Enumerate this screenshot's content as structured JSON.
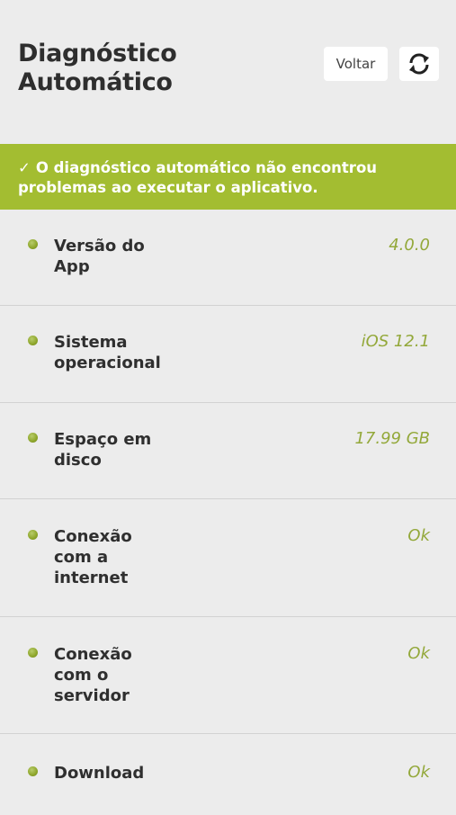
{
  "header": {
    "title_line1": "Diagnóstico",
    "title_line2": "Automático",
    "back_label": "Voltar"
  },
  "banner": {
    "check": "✓",
    "message": "O diagnóstico automático não encontrou problemas ao executar o aplicativo."
  },
  "colors": {
    "accent": "#a3bd31",
    "value_text": "#93a83a",
    "background": "#ececec"
  },
  "items": [
    {
      "label": "Versão do App",
      "value": "4.0.0"
    },
    {
      "label": "Sistema operacional",
      "value": "iOS 12.1"
    },
    {
      "label": "Espaço em disco",
      "value": "17.99 GB"
    },
    {
      "label": "Conexão com a internet",
      "value": "Ok"
    },
    {
      "label": "Conexão com o servidor",
      "value": "Ok"
    },
    {
      "label": "Download",
      "value": "Ok"
    }
  ]
}
